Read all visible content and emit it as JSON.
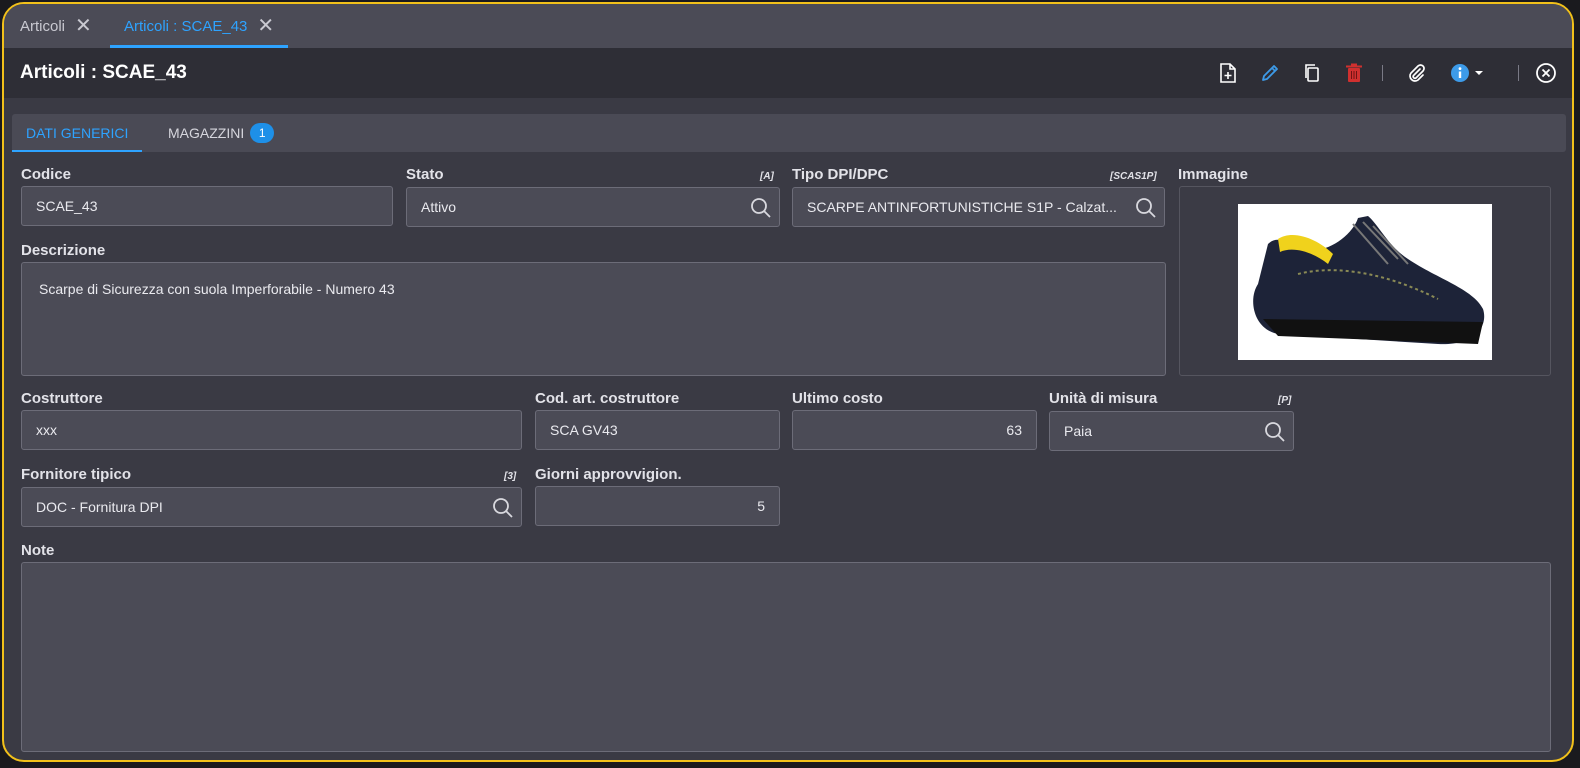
{
  "doc_tabs": [
    {
      "label": "Articoli",
      "active": false
    },
    {
      "label": "Articoli : SCAE_43",
      "active": true
    }
  ],
  "header": {
    "title": "Articoli : SCAE_43"
  },
  "toolbar": {
    "icons": [
      "new-document-icon",
      "edit-pencil-icon",
      "copy-icon",
      "delete-trash-icon",
      "attachment-paperclip-icon",
      "info-icon",
      "close-circle-icon"
    ],
    "colors": {
      "edit": "#3d9be9",
      "delete": "#d0302f",
      "info": "#3d9be9",
      "default": "#ffffff"
    }
  },
  "sub_tabs": [
    {
      "label": "DATI GENERICI",
      "active": true
    },
    {
      "label": "MAGAZZINI",
      "badge": "1"
    }
  ],
  "form": {
    "codice": {
      "label": "Codice",
      "value": "SCAE_43"
    },
    "stato": {
      "label": "Stato",
      "code": "[A]",
      "value": "Attivo"
    },
    "tipo_dpi": {
      "label": "Tipo DPI/DPC",
      "code": "[SCAS1P]",
      "value": "SCARPE ANTINFORTUNISTICHE S1P - Calzat..."
    },
    "immagine": {
      "label": "Immagine"
    },
    "descrizione": {
      "label": "Descrizione",
      "value": "Scarpe di Sicurezza con suola Imperforabile - Numero 43"
    },
    "costruttore": {
      "label": "Costruttore",
      "value": "xxx"
    },
    "cod_art": {
      "label": "Cod. art. costruttore",
      "value": "SCA GV43"
    },
    "ultimo_costo": {
      "label": "Ultimo costo",
      "value": "63"
    },
    "unita": {
      "label": "Unità di misura",
      "code": "[P]",
      "value": "Paia"
    },
    "fornitore": {
      "label": "Fornitore tipico",
      "code": "[3]",
      "value": "DOC - Fornitura DPI"
    },
    "giorni": {
      "label": "Giorni approvvigion.",
      "value": "5"
    },
    "note": {
      "label": "Note",
      "value": ""
    }
  },
  "colors": {
    "accent": "#2ea3ff",
    "frame": "#f2c11a"
  }
}
